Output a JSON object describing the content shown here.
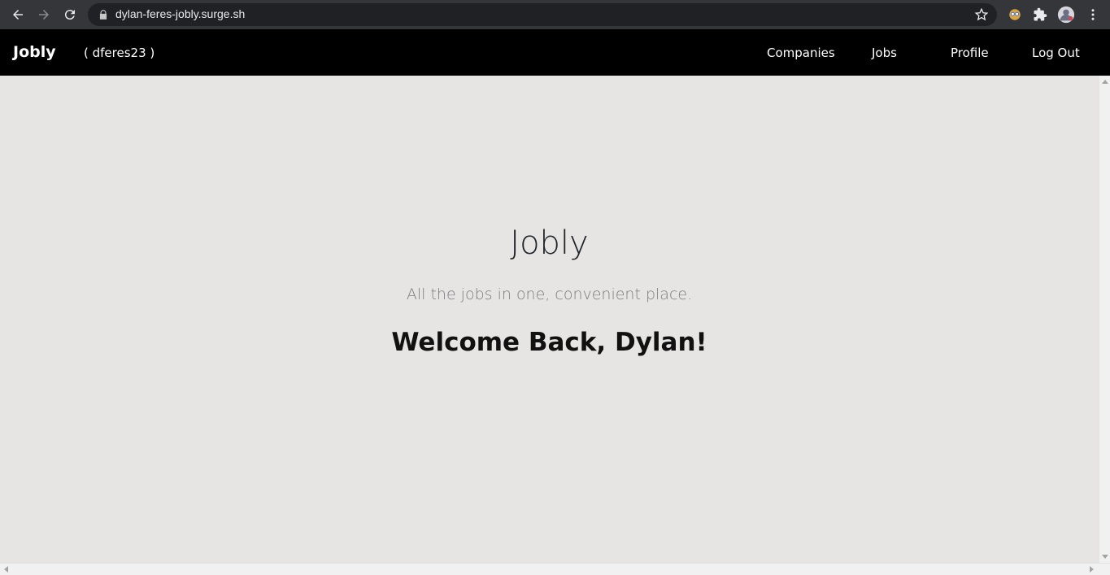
{
  "browser": {
    "url": "dylan-feres-jobly.surge.sh"
  },
  "navbar": {
    "brand": "Jobly",
    "username": "( dferes23 )",
    "links": [
      "Companies",
      "Jobs",
      "Profile",
      "Log Out"
    ]
  },
  "hero": {
    "title": "Jobly",
    "lead": "All the jobs in one, convenient place.",
    "welcome": "Welcome Back, Dylan!"
  }
}
